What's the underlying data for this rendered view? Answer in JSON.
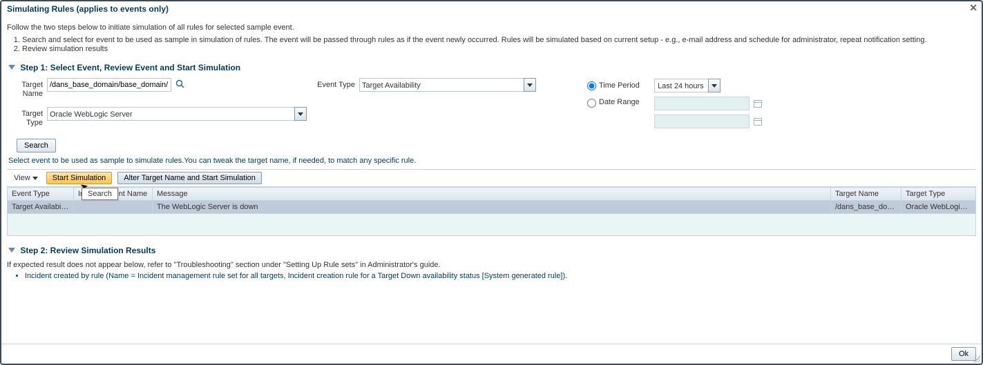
{
  "dialog": {
    "title": "Simulating Rules (applies to events only)",
    "intro": "Follow the two steps below to initiate simulation of all rules for selected sample event.",
    "step_list": {
      "s1": "Search and select for event to be used as sample in simulation of rules. The event will be passed through rules as if the event newly occurred. Rules will be simulated based on current setup - e.g., e-mail address and schedule for administrator, repeat notification setting.",
      "s2": "Review simulation results"
    }
  },
  "step1": {
    "header": "Step 1: Select Event, Review Event and Start Simulation",
    "target_name_label": "Target Name",
    "target_name_value": "/dans_base_domain/base_domain/I",
    "target_type_label": "Target Type",
    "target_type_value": "Oracle WebLogic Server",
    "event_type_label": "Event Type",
    "event_type_value": "Target Availability",
    "time_period_label": "Time Period",
    "time_period_value": "Last 24 hours",
    "date_range_label": "Date Range",
    "search_button": "Search",
    "instruction": "Select event to be used as sample to simulate rules.You can tweak the target name, if needed, to match any specific rule."
  },
  "toolbar": {
    "view_label": "View",
    "start_sim": "Start Simulation",
    "alter_sim": "Alter Target Name and Start Simulation",
    "tooltip": "Search"
  },
  "table": {
    "cols": {
      "event_type": "Event Type",
      "internal_name": "Internal Event Name",
      "message": "Message",
      "target_name": "Target Name",
      "target_type": "Target Type"
    },
    "row": {
      "event_type": "Target Availability",
      "internal_name": "",
      "message": "The WebLogic Server is down",
      "target_name": "/dans_base_domai…",
      "target_type": "Oracle WebLogic S…"
    }
  },
  "step2": {
    "header": "Step 2: Review Simulation Results",
    "note": "If expected result does not appear below, refer to \"Troubleshooting\" section under \"Setting Up Rule sets\" in Administrator's guide.",
    "result": "Incident created by rule (Name = Incident management rule set for all targets, Incident creation rule for a Target Down availability status [System generated rule])."
  },
  "footer": {
    "ok": "Ok"
  }
}
